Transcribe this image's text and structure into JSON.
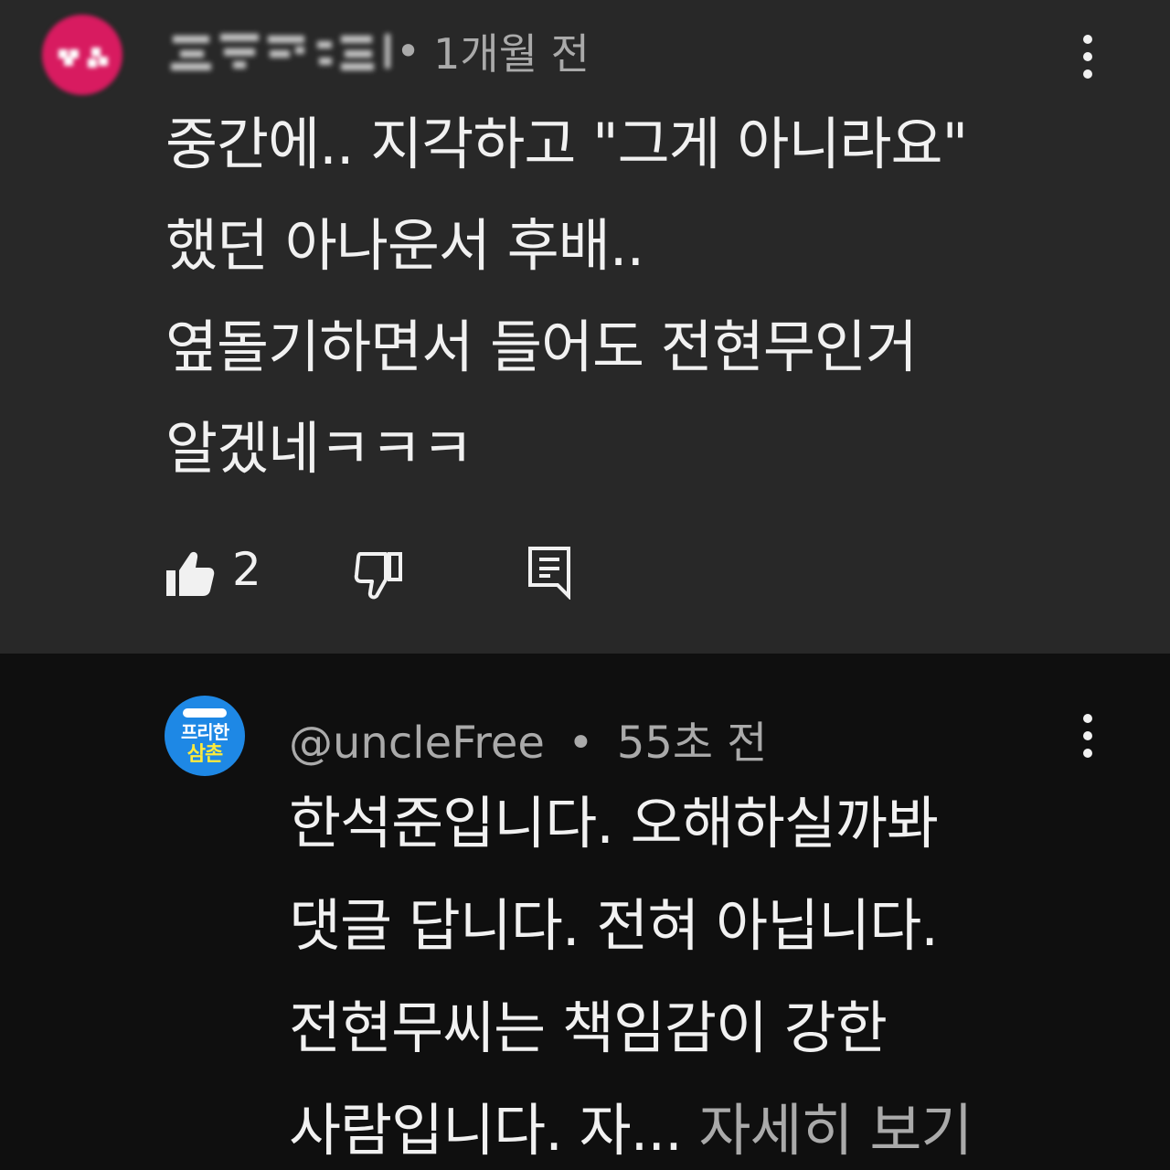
{
  "comments": [
    {
      "author": "",
      "time": "1개월 전",
      "text": "중간에.. 지각하고 \"그게 아니라요\"\n했던 아나운서 후배..\n옆돌기하면서 들어도 전현무인거\n알겠네ㅋㅋㅋ",
      "likes": "2",
      "avatar_color": "#d81b60"
    },
    {
      "author": "@uncleFree",
      "time": "55초 전",
      "text": "한석준입니다. 오해하실까봐\n댓글 답니다. 전혀 아닙니다.\n전현무씨는 책임감이 강한\n사람입니다. 자...",
      "read_more": "자세히 보기",
      "avatar_line1": "프리한",
      "avatar_line2": "삼촌",
      "avatar_color": "#1e88e5"
    }
  ],
  "separator": "•",
  "icons": {
    "like": "thumbs-up-filled-icon",
    "dislike": "thumbs-down-outline-icon",
    "reply": "reply-comment-icon",
    "more": "more-vertical-icon"
  },
  "colors": {
    "highlight_bg": "#282828",
    "page_bg": "#0f0f0f",
    "text_primary": "#f1f1f1",
    "text_secondary": "#aaaaaa"
  }
}
